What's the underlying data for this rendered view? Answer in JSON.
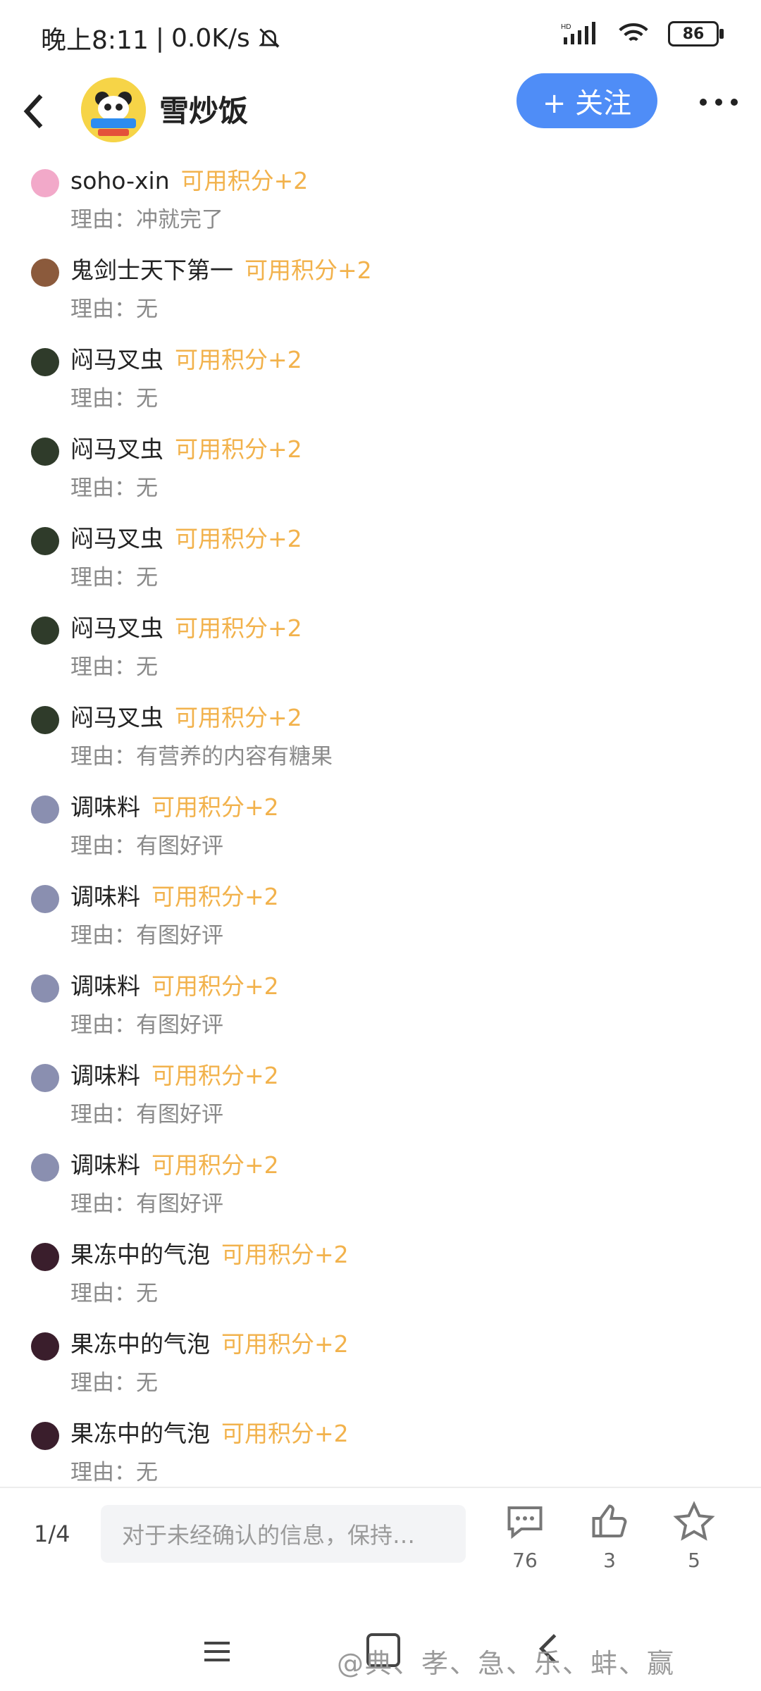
{
  "status_bar": {
    "time": "晚上8:11",
    "speed": "0.0K/s",
    "separator": "|",
    "battery": "86",
    "network_label": "HD"
  },
  "header": {
    "title": "雪炒饭",
    "follow_label": "+ 关注"
  },
  "rows": [
    {
      "user": "soho-xin",
      "points": "可用积分+2",
      "reason": "理由：冲就完了",
      "avatar_color": "#f2a9c9"
    },
    {
      "user": "鬼剑士天下第一",
      "points": "可用积分+2",
      "reason": "理由：无",
      "avatar_color": "#8b5a3c"
    },
    {
      "user": "闷马叉虫",
      "points": "可用积分+2",
      "reason": "理由：无",
      "avatar_color": "#2f3b2a"
    },
    {
      "user": "闷马叉虫",
      "points": "可用积分+2",
      "reason": "理由：无",
      "avatar_color": "#2f3b2a"
    },
    {
      "user": "闷马叉虫",
      "points": "可用积分+2",
      "reason": "理由：无",
      "avatar_color": "#2f3b2a"
    },
    {
      "user": "闷马叉虫",
      "points": "可用积分+2",
      "reason": "理由：无",
      "avatar_color": "#2f3b2a"
    },
    {
      "user": "闷马叉虫",
      "points": "可用积分+2",
      "reason": "理由：有营养的内容有糖果",
      "avatar_color": "#2f3b2a"
    },
    {
      "user": "调味料",
      "points": "可用积分+2",
      "reason": "理由：有图好评",
      "avatar_color": "#8a8fb0"
    },
    {
      "user": "调味料",
      "points": "可用积分+2",
      "reason": "理由：有图好评",
      "avatar_color": "#8a8fb0"
    },
    {
      "user": "调味料",
      "points": "可用积分+2",
      "reason": "理由：有图好评",
      "avatar_color": "#8a8fb0"
    },
    {
      "user": "调味料",
      "points": "可用积分+2",
      "reason": "理由：有图好评",
      "avatar_color": "#8a8fb0"
    },
    {
      "user": "调味料",
      "points": "可用积分+2",
      "reason": "理由：有图好评",
      "avatar_color": "#8a8fb0"
    },
    {
      "user": "果冻中的气泡",
      "points": "可用积分+2",
      "reason": "理由：无",
      "avatar_color": "#3a1e2c"
    },
    {
      "user": "果冻中的气泡",
      "points": "可用积分+2",
      "reason": "理由：无",
      "avatar_color": "#3a1e2c"
    },
    {
      "user": "果冻中的气泡",
      "points": "可用积分+2",
      "reason": "理由：无",
      "avatar_color": "#3a1e2c"
    }
  ],
  "bottom_bar": {
    "page_indicator": "1/4",
    "comment_placeholder": "对于未经确认的信息，保持…",
    "comments": "76",
    "likes": "3",
    "favorites": "5"
  },
  "watermark": "@典、孝、急、乐、蚌、赢",
  "colors": {
    "points": "#f2b24c",
    "follow_button": "#4f8df7"
  }
}
